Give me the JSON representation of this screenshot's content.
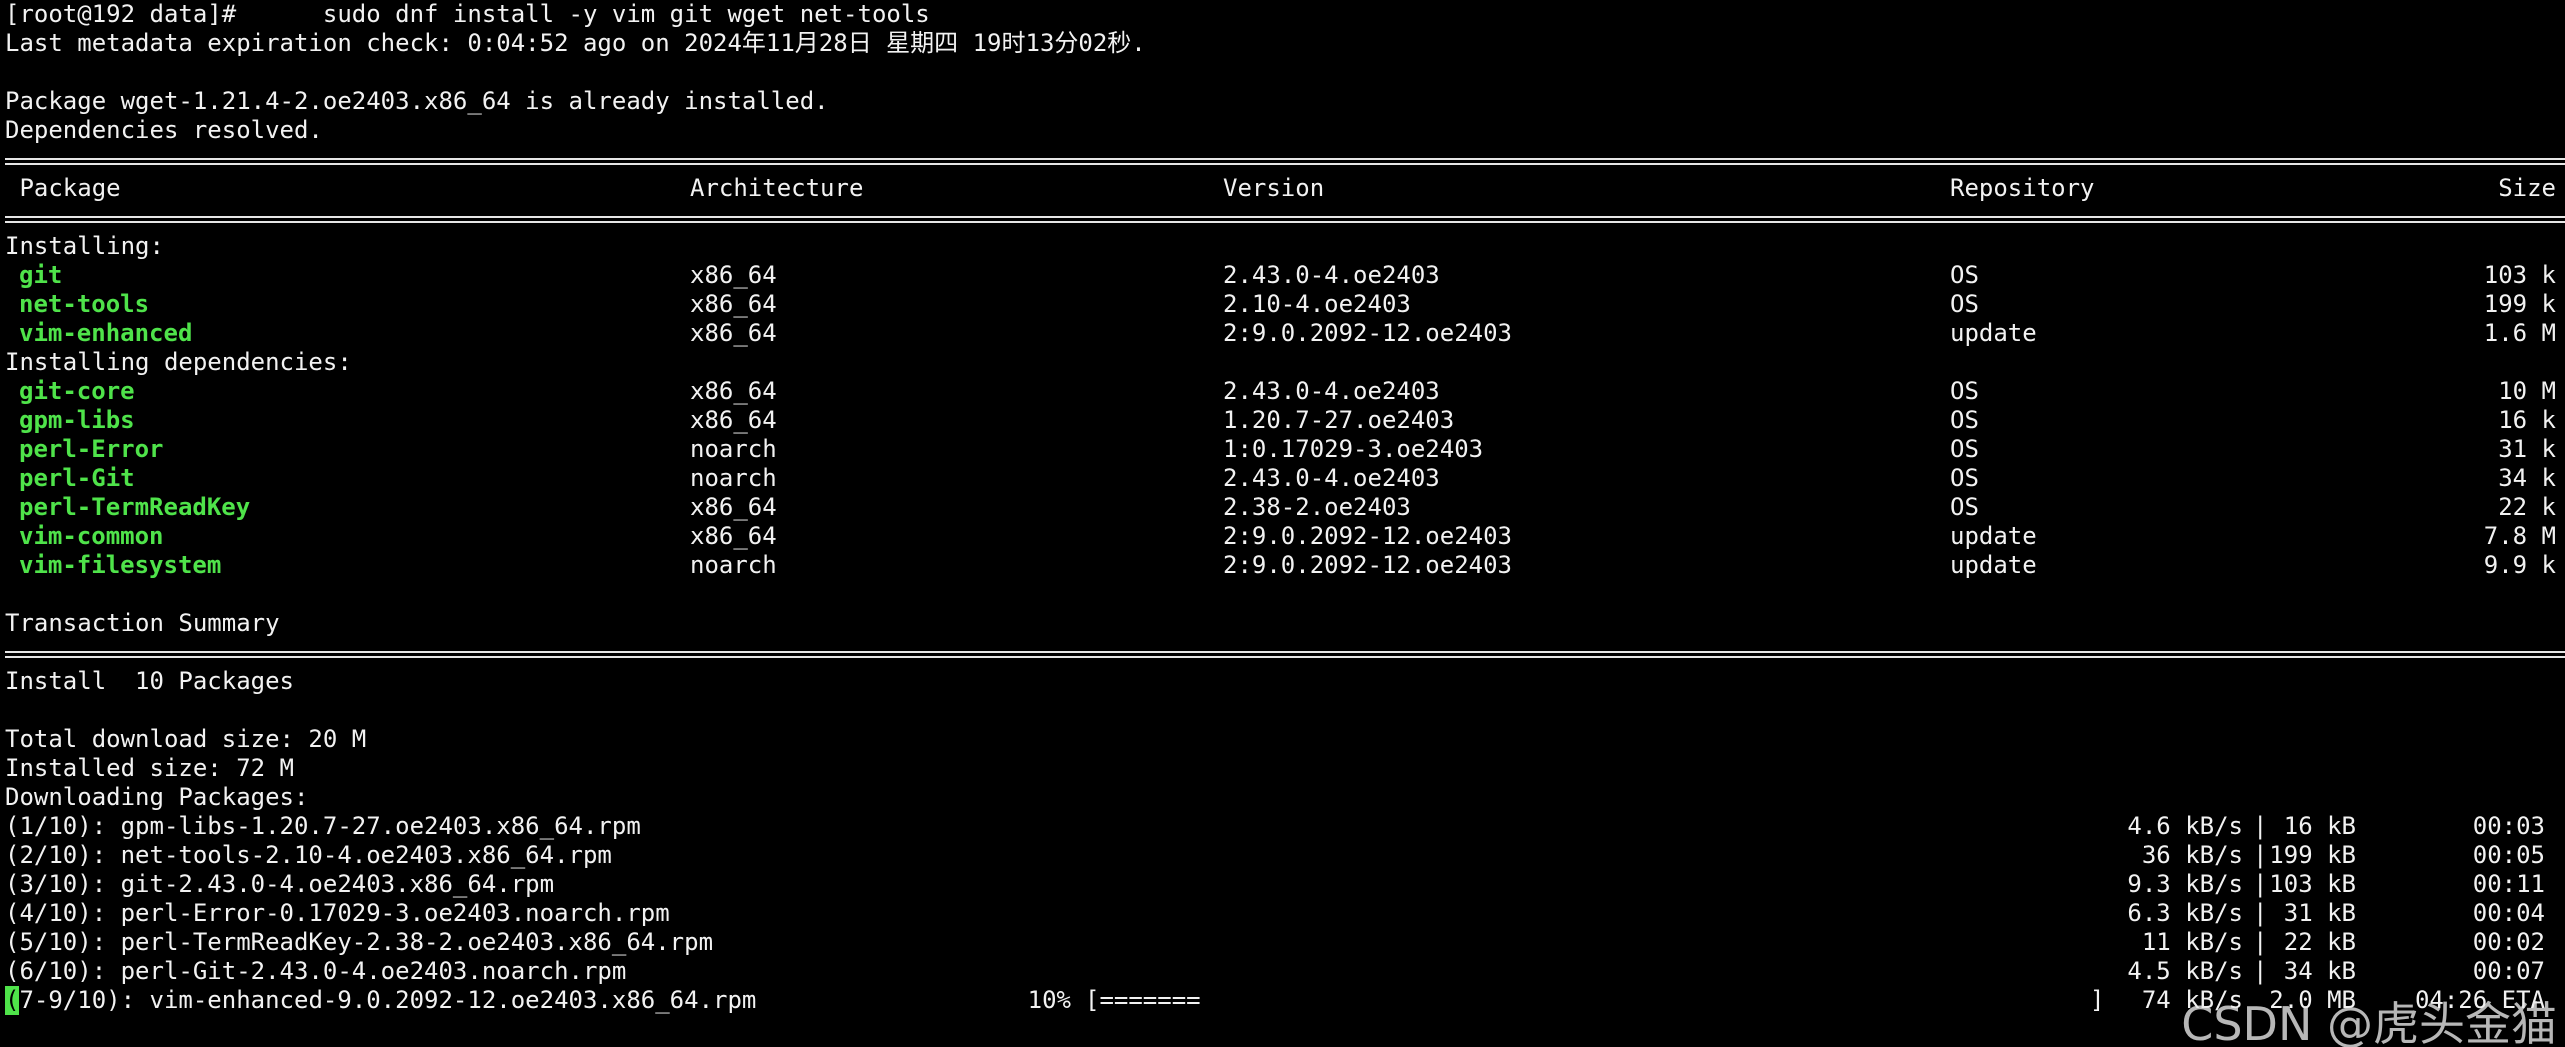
{
  "command_prompt": "[root@192 data]#      sudo dnf install -y vim git wget net-tools",
  "metadata_line": "Last metadata expiration check: 0:04:52 ago on 2024年11月28日 星期四 19时13分02秒.",
  "already_installed": "Package wget-1.21.4-2.oe2403.x86_64 is already installed.",
  "dependencies_resolved": "Dependencies resolved.",
  "table": {
    "headers": {
      "package": " Package",
      "architecture": "Architecture",
      "version": "Version",
      "repository": "Repository",
      "size": "Size"
    },
    "installing_label": "Installing:",
    "installing": [
      {
        "name": "git",
        "arch": "x86_64",
        "version": "2.43.0-4.oe2403",
        "repo": "OS",
        "size": "103 k"
      },
      {
        "name": "net-tools",
        "arch": "x86_64",
        "version": "2.10-4.oe2403",
        "repo": "OS",
        "size": "199 k"
      },
      {
        "name": "vim-enhanced",
        "arch": "x86_64",
        "version": "2:9.0.2092-12.oe2403",
        "repo": "update",
        "size": "1.6 M"
      }
    ],
    "dependencies_label": "Installing dependencies:",
    "dependencies": [
      {
        "name": "git-core",
        "arch": "x86_64",
        "version": "2.43.0-4.oe2403",
        "repo": "OS",
        "size": "10 M"
      },
      {
        "name": "gpm-libs",
        "arch": "x86_64",
        "version": "1.20.7-27.oe2403",
        "repo": "OS",
        "size": "16 k"
      },
      {
        "name": "perl-Error",
        "arch": "noarch",
        "version": "1:0.17029-3.oe2403",
        "repo": "OS",
        "size": "31 k"
      },
      {
        "name": "perl-Git",
        "arch": "noarch",
        "version": "2.43.0-4.oe2403",
        "repo": "OS",
        "size": "34 k"
      },
      {
        "name": "perl-TermReadKey",
        "arch": "x86_64",
        "version": "2.38-2.oe2403",
        "repo": "OS",
        "size": "22 k"
      },
      {
        "name": "vim-common",
        "arch": "x86_64",
        "version": "2:9.0.2092-12.oe2403",
        "repo": "update",
        "size": "7.8 M"
      },
      {
        "name": "vim-filesystem",
        "arch": "noarch",
        "version": "2:9.0.2092-12.oe2403",
        "repo": "update",
        "size": "9.9 k"
      }
    ]
  },
  "transaction_summary": "Transaction Summary",
  "install_count": "Install  10 Packages",
  "total_download": "Total download size: 20 M",
  "installed_size": "Installed size: 72 M",
  "downloading_label": "Downloading Packages:",
  "downloads": [
    {
      "file": "(1/10): gpm-libs-1.20.7-27.oe2403.x86_64.rpm",
      "speed": "4.6 kB/s",
      "size": " 16 kB",
      "time": "00:03"
    },
    {
      "file": "(2/10): net-tools-2.10-4.oe2403.x86_64.rpm",
      "speed": "36 kB/s",
      "size": "199 kB",
      "time": "00:05"
    },
    {
      "file": "(3/10): git-2.43.0-4.oe2403.x86_64.rpm",
      "speed": "9.3 kB/s",
      "size": "103 kB",
      "time": "00:11"
    },
    {
      "file": "(4/10): perl-Error-0.17029-3.oe2403.noarch.rpm",
      "speed": "6.3 kB/s",
      "size": " 31 kB",
      "time": "00:04"
    },
    {
      "file": "(5/10): perl-TermReadKey-2.38-2.oe2403.x86_64.rpm",
      "speed": "11 kB/s",
      "size": " 22 kB",
      "time": "00:02"
    },
    {
      "file": "(6/10): perl-Git-2.43.0-4.oe2403.noarch.rpm",
      "speed": "4.5 kB/s",
      "size": " 34 kB",
      "time": "00:07"
    }
  ],
  "progress": {
    "cursor_char": "(",
    "file": "7-9/10): vim-enhanced-9.0.2092-12.oe2403.x86_64.rpm",
    "percent": "10%",
    "bar_open": "[=======",
    "bar_close": "]",
    "speed": "74 kB/s",
    "size": "2.0 MB",
    "eta": "04:26 ETA"
  },
  "watermark": "CSDN @虎头金猫",
  "colors": {
    "background": "#000000",
    "foreground": "#f2f2f2",
    "package_name": "#4fe34a",
    "cursor": "#4fe34a"
  }
}
